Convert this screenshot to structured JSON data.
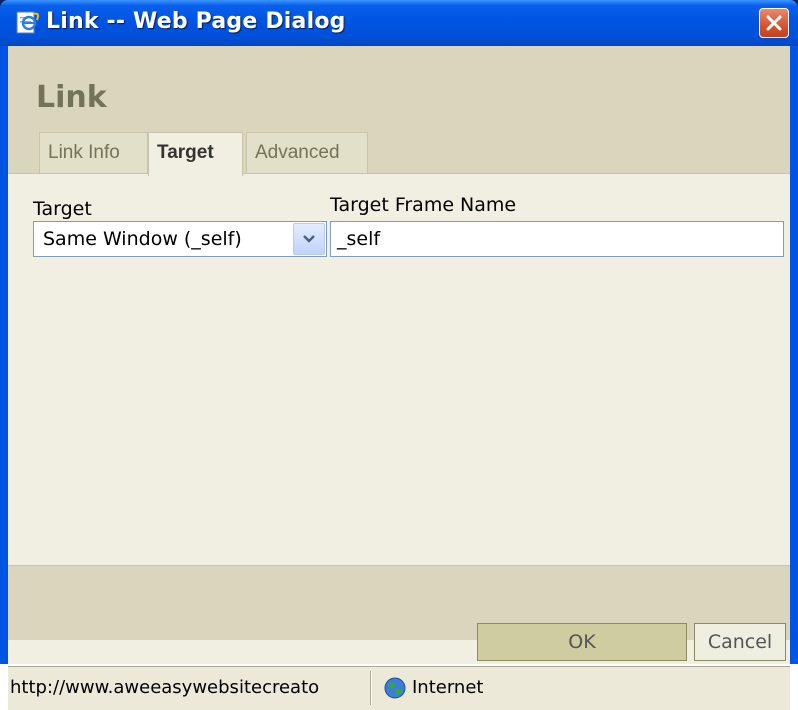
{
  "window": {
    "title": "Link -- Web Page Dialog",
    "icon": "ie-page-icon",
    "close_icon": "close-icon"
  },
  "dialog": {
    "heading": "Link",
    "tabs": [
      {
        "label": "Link Info",
        "active": false
      },
      {
        "label": "Target",
        "active": true
      },
      {
        "label": "Advanced",
        "active": false
      }
    ]
  },
  "target_panel": {
    "target_label": "Target",
    "target_value": "Same Window (_self)",
    "frame_name_label": "Target Frame Name",
    "frame_name_value": "_self"
  },
  "buttons": {
    "ok_label": "OK",
    "cancel_label": "Cancel"
  },
  "statusbar": {
    "url": "http://www.aweeasywebsitecreato",
    "zone_icon": "globe-icon",
    "zone": "Internet"
  },
  "colors": {
    "titlebar": "#0054e3",
    "panel_bg": "#f1efe2",
    "header_band": "#d9d6bd",
    "heading_text": "#737357",
    "close_button": "#d5542f"
  }
}
